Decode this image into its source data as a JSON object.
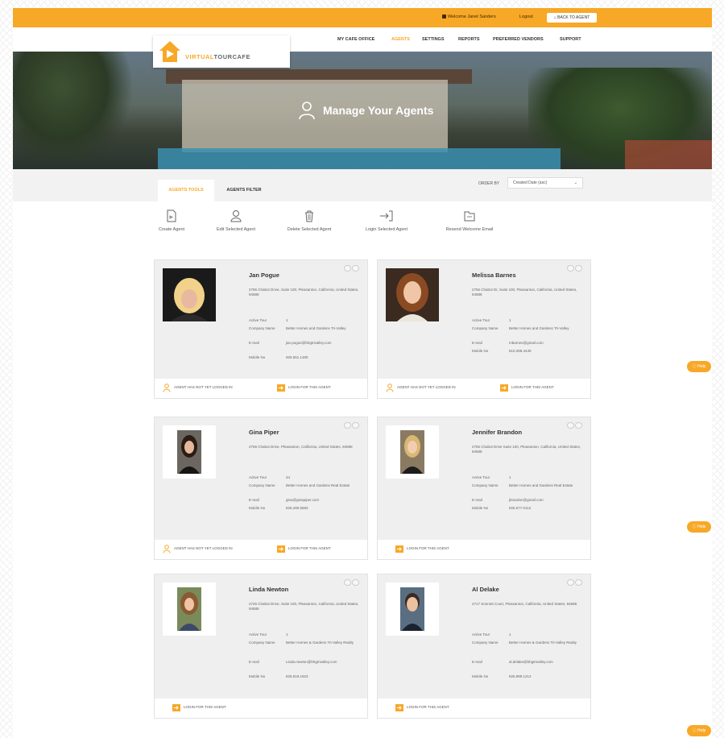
{
  "topbar": {
    "welcome": "Welcome Janet Sanders",
    "logout": "Logout",
    "back_button": "BACK TO AGENT"
  },
  "logo": {
    "text_left": "VIRTUAL",
    "text_right": "TOURCAFE"
  },
  "nav": {
    "items": [
      "MY CAFE OFFICE",
      "AGENTS",
      "SETTINGS",
      "REPORTS",
      "PREFERRED VENDORS",
      "SUPPORT"
    ],
    "active": "AGENTS"
  },
  "hero": {
    "title": "Manage Your Agents"
  },
  "tabs": {
    "items": [
      "AGENTS TOOLS",
      "AGENTS FILTER"
    ],
    "active_index": 0
  },
  "sortby": {
    "label": "ORDER BY",
    "value": "Created Date (asc)"
  },
  "actions": [
    {
      "label": "Create Agent",
      "icon": "add-document-icon"
    },
    {
      "label": "Edit Selected Agent",
      "icon": "user-icon"
    },
    {
      "label": "Delete Selected Agent",
      "icon": "trash-icon"
    },
    {
      "label": "Login Selected Agent",
      "icon": "login-icon"
    },
    {
      "label": "Resend Welcome Email",
      "icon": "folder-icon"
    }
  ],
  "field_labels": {
    "active_tours": "Active Tour",
    "company": "Company Name",
    "email": "E-mail",
    "mobile": "Mobile No"
  },
  "footer_labels": {
    "not_logged": "AGENT HAS NOT YET LOGGED IN",
    "login": "LOGIN FOR THIS AGENT"
  },
  "agents": [
    {
      "name": "Jan Pogue",
      "address": "2755 Chabot Drive, Suite 100, Pleasanton, California, United States, 94588",
      "active_tours": "1",
      "company": "Better Homes and Gardens Tri-Valley",
      "email": "jan.pogue@bhgtrivalley.com",
      "mobile": "925.551.1480",
      "not_logged": true
    },
    {
      "name": "Melissa Barnes",
      "address": "2755 Chabot Dr, Suite 100, Pleasanton, California, United States, 94588",
      "active_tours": "1",
      "company": "Better Homes and Gardens Tri-Valley",
      "email": "mbarnes@gmail.com",
      "mobile": "510.289.4449",
      "not_logged": true
    },
    {
      "name": "Gina Piper",
      "address": "2755 Chabot Drive, Pleasanton, California, United States, 94588",
      "active_tours": "24",
      "company": "Better Homes and Gardens Real Estate",
      "email": "gina@ginapiper.com",
      "mobile": "925.290.5583",
      "not_logged": true
    },
    {
      "name": "Jennifer Brandon",
      "address": "2755 Chabot Drive Suite 100, Pleasanton, California, United States, 94588",
      "active_tours": "1",
      "company": "Better Homes and Gardens Real Estate",
      "email": "jbrandon@gmail.com",
      "mobile": "925.577.0112",
      "not_logged": false
    },
    {
      "name": "Linda Newton",
      "address": "4725 Chabot Drive, Suite 100, Pleasanton, California, United States, 94588",
      "active_tours": "1",
      "company": "Better Homes & Gardens Tri-Valley Realty",
      "email": "Linda.newton@bhgtrivalley.com",
      "mobile": "925.519.1923",
      "not_logged": false
    },
    {
      "name": "Al Delake",
      "address": "4717 Sonnett Court, Pleasanton, California, United States, 94588",
      "active_tours": "1",
      "company": "Better Homes & Gardens Tri-Valley Realty",
      "email": "al.delake@bhgtrivalley.com",
      "mobile": "925.989.1212",
      "not_logged": false
    }
  ],
  "help": {
    "label": "Help"
  },
  "colors": {
    "accent": "#f7a827",
    "card_bg": "#efefef"
  }
}
